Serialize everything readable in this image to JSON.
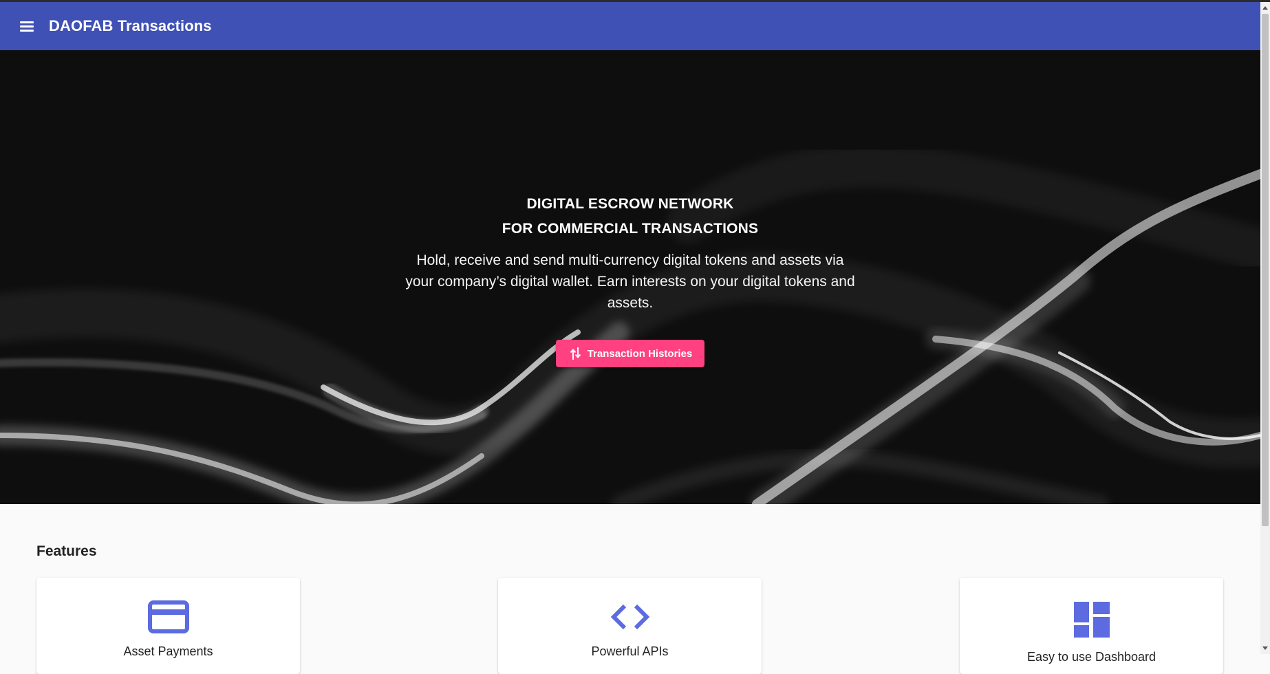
{
  "toolbar": {
    "title": "DAOFAB Transactions",
    "menu_icon": "menu-icon",
    "color": "#3f51b5"
  },
  "hero": {
    "headline_line1": "DIGITAL ESCROW NETWORK",
    "headline_line2": "FOR COMMERCIAL TRANSACTIONS",
    "subtitle": "Hold, receive and send multi-currency digital tokens and assets via your company’s digital wallet. Earn interests on your digital tokens and assets.",
    "cta_label": "Transaction Histories",
    "cta_icon": "swap-vert-icon",
    "cta_color": "#ff4081"
  },
  "features": {
    "title": "Features",
    "items": [
      {
        "label": "Asset Payments",
        "icon": "credit-card-icon"
      },
      {
        "label": "Powerful APIs",
        "icon": "code-icon"
      },
      {
        "label": "Easy to use Dashboard",
        "icon": "dashboard-icon"
      }
    ],
    "icon_color": "#5c6bdf"
  }
}
